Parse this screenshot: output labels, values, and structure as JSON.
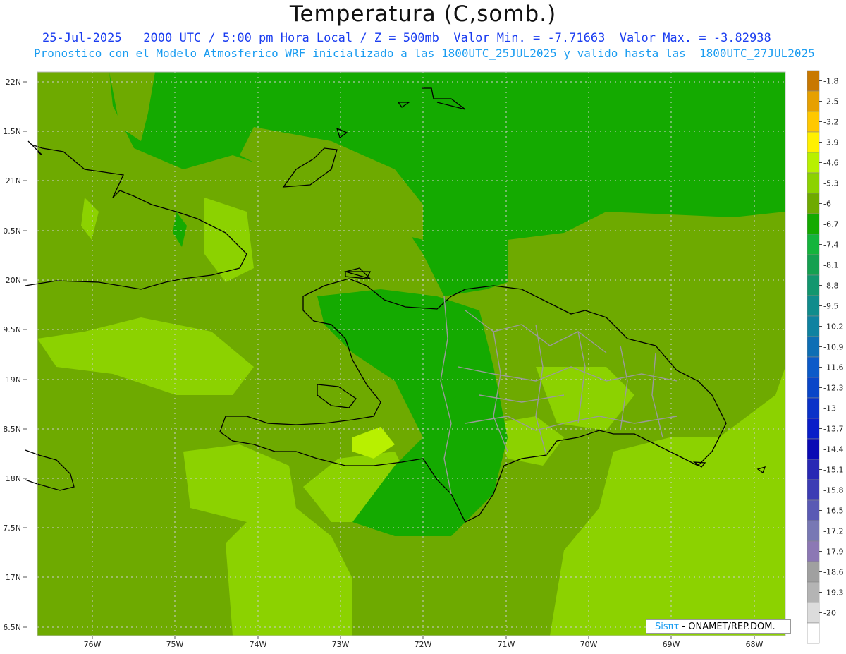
{
  "header": {
    "title": "Temperatura (C,somb.)",
    "subtitle1": "25-Jul-2025   2000 UTC / 5:00 pm Hora Local / Z = 500mb  Valor Min. = -7.71663  Valor Max. = -3.82938",
    "subtitle2": "Pronostico con el Modelo Atmosferico WRF inicializado a las 1800UTC_25JUL2025 y valido hasta las  1800UTC_27JUL2025"
  },
  "map": {
    "lat_labels": [
      "22N",
      "1.5N",
      "21N",
      "0.5N",
      "20N",
      "9.5N",
      "19N",
      "8.5N",
      "18N",
      "7.5N",
      "17N",
      "6.5N"
    ],
    "lon_labels": [
      "76W",
      "75W",
      "74W",
      "73W",
      "72W",
      "71W",
      "70W",
      "69W",
      "68W"
    ]
  },
  "colorbar": {
    "levels": [
      {
        "label": "-1.8",
        "color": "#c87800"
      },
      {
        "label": "-2.5",
        "color": "#e6a000"
      },
      {
        "label": "-3.2",
        "color": "#ffc800"
      },
      {
        "label": "-3.9",
        "color": "#fff000"
      },
      {
        "label": "-4.6",
        "color": "#b8f000"
      },
      {
        "label": "-5.3",
        "color": "#8cd200"
      },
      {
        "label": "-6",
        "color": "#6eaa00"
      },
      {
        "label": "-6.7",
        "color": "#14aa00"
      },
      {
        "label": "-7.4",
        "color": "#14b43c"
      },
      {
        "label": "-8.1",
        "color": "#14a050"
      },
      {
        "label": "-8.8",
        "color": "#12966e"
      },
      {
        "label": "-9.5",
        "color": "#108c8c"
      },
      {
        "label": "-10.2",
        "color": "#0f82a0"
      },
      {
        "label": "-10.9",
        "color": "#0e6eb4"
      },
      {
        "label": "-11.6",
        "color": "#0c5ac8"
      },
      {
        "label": "-12.3",
        "color": "#0a46c8"
      },
      {
        "label": "-13",
        "color": "#0a32c8"
      },
      {
        "label": "-13.7",
        "color": "#0a1ec8"
      },
      {
        "label": "-14.4",
        "color": "#0a0ab4"
      },
      {
        "label": "-15.1",
        "color": "#2828b4"
      },
      {
        "label": "-15.8",
        "color": "#3c3cb4"
      },
      {
        "label": "-16.5",
        "color": "#5a5ab4"
      },
      {
        "label": "-17.2",
        "color": "#7878b4"
      },
      {
        "label": "-17.9",
        "color": "#8c78b4"
      },
      {
        "label": "-18.6",
        "color": "#a0a0a0"
      },
      {
        "label": "-19.3",
        "color": "#b4b4b4"
      },
      {
        "label": "-20",
        "color": "#dcdcdc"
      },
      {
        "label": "",
        "color": "#ffffff"
      }
    ]
  },
  "credit": {
    "logo": "Sisπτ",
    "text": " - ONAMET/REP.DOM."
  }
}
